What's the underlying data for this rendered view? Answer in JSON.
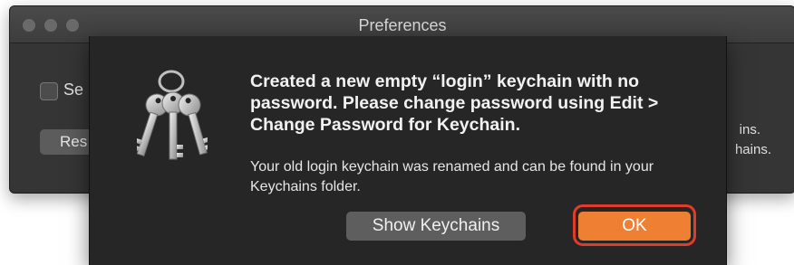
{
  "window": {
    "title": "Preferences",
    "checkbox_label": "Se",
    "button_label": "Res",
    "note_line1": "ins.",
    "note_line2": "hains."
  },
  "dialog": {
    "icon": "keychain-keys-icon",
    "title": "Created a new empty “login” keychain with no password. Please change password using Edit > Change Password for Keychain.",
    "message": "Your old login keychain was renamed and can be found in your Keychains folder.",
    "buttons": {
      "show_keychains": "Show Keychains",
      "ok": "OK"
    }
  },
  "colors": {
    "primary_button": "#ee7f33",
    "highlight_ring": "#e03c2a",
    "dialog_bg": "#262626"
  }
}
